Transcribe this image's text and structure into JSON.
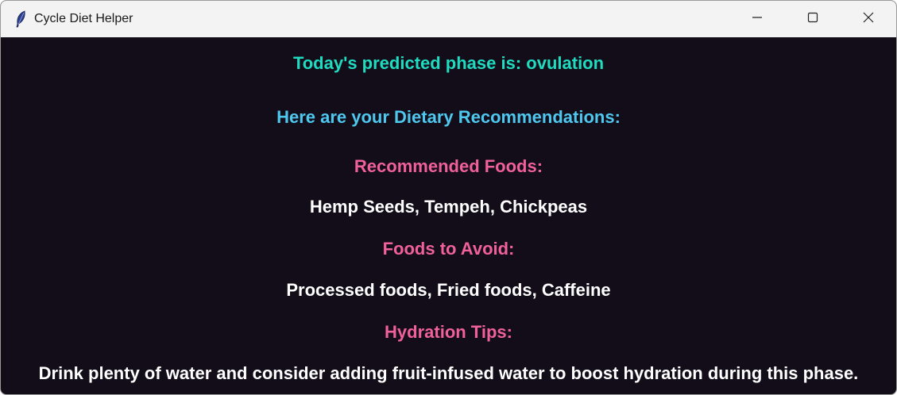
{
  "window": {
    "title": "Cycle Diet Helper",
    "icon": "feather-icon",
    "controls": [
      "minimize-icon",
      "maximize-icon",
      "close-icon"
    ]
  },
  "content": {
    "phase_text": "Today's predicted phase is: ovulation",
    "intro": "Here are your Dietary Recommendations:",
    "recommended_heading": "Recommended Foods:",
    "recommended_items": "Hemp Seeds, Tempeh, Chickpeas",
    "avoid_heading": "Foods to Avoid:",
    "avoid_items": "Processed foods, Fried foods, Caffeine",
    "hydration_heading": "Hydration Tips:",
    "hydration_tip": "Drink plenty of water and consider adding fruit-infused water to boost hydration during this phase."
  },
  "colors": {
    "background": "#120d19",
    "phase": "#1fdcc0",
    "intro": "#4fc8f0",
    "heading": "#f0609a",
    "body_text": "#ffffff"
  }
}
